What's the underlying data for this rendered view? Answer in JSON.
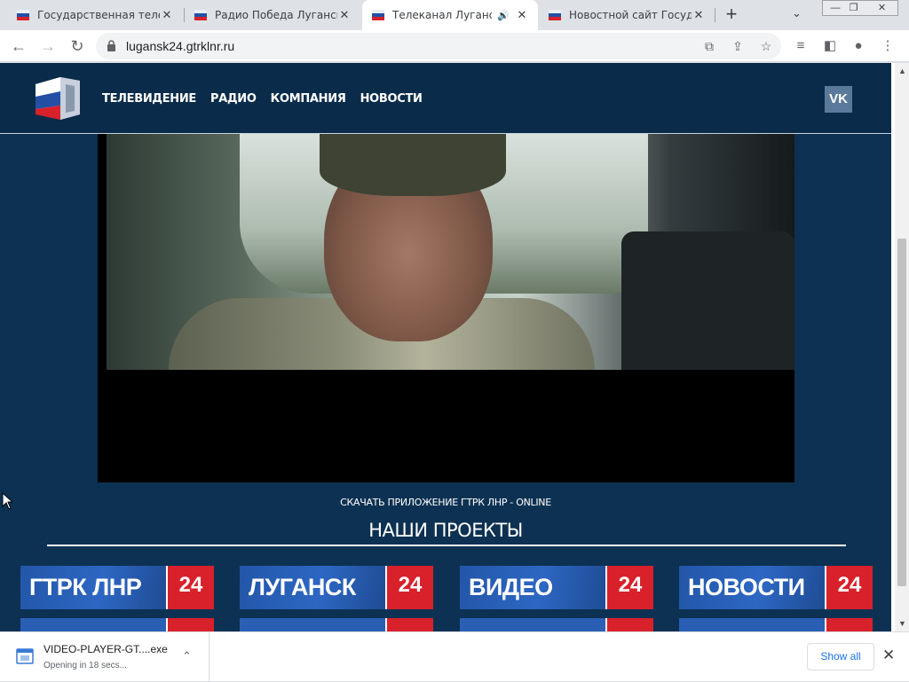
{
  "browser": {
    "tabs": [
      {
        "title": "Государственная телевиз",
        "icon": "gtrk-favicon",
        "active": false
      },
      {
        "title": "Радио Победа Луганск Л",
        "icon": "gtrk-favicon",
        "active": false
      },
      {
        "title": "Телеканал Луганск 24",
        "icon": "gtrk-favicon",
        "active": true,
        "audio": true
      },
      {
        "title": "Новостной сайт Государ",
        "icon": "gtrk-favicon",
        "active": false
      }
    ],
    "new_tab_label": "+",
    "url": "lugansk24.gtrklnr.ru"
  },
  "site": {
    "nav": [
      "ТЕЛЕВИДЕНИЕ",
      "РАДИО",
      "КОМПАНИЯ",
      "НОВОСТИ"
    ],
    "vk_label": "VK",
    "download_app": "СКАЧАТЬ ПРИЛОЖЕНИЕ ГТРК ЛНР - ONLINE",
    "projects_title": "НАШИ ПРОЕКТЫ",
    "projects": [
      {
        "name": "ГТРК ЛНР",
        "number": "24"
      },
      {
        "name": "ЛУГАНСК",
        "number": "24"
      },
      {
        "name": "ВИДЕО",
        "number": "24"
      },
      {
        "name": "НОВОСТИ",
        "number": "24"
      }
    ]
  },
  "downloads": {
    "file_name": "VIDEO-PLAYER-GT....exe",
    "status": "Opening in 18 secs...",
    "show_all": "Show all"
  },
  "colors": {
    "site_bg": "#0d3152",
    "header_bg": "#0a2c4a",
    "project_blue": "#2d67c3",
    "project_red": "#d8212a"
  }
}
